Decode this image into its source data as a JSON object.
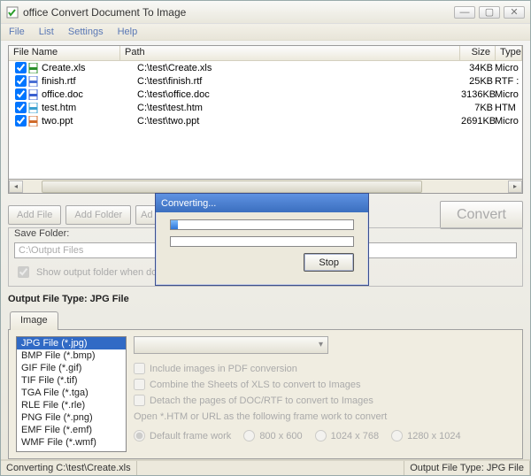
{
  "window": {
    "title": "office Convert Document To Image",
    "buttons": {
      "min": "—",
      "max": "▢",
      "close": "✕"
    }
  },
  "menu": [
    "File",
    "List",
    "Settings",
    "Help"
  ],
  "grid": {
    "columns": {
      "name": "File Name",
      "path": "Path",
      "size": "Size",
      "type": "Type"
    },
    "rows": [
      {
        "checked": true,
        "icon": "xls",
        "name": "Create.xls",
        "path": "C:\\test\\Create.xls",
        "size": "34KB",
        "type": "Micro"
      },
      {
        "checked": true,
        "icon": "rtf",
        "name": "finish.rtf",
        "path": "C:\\test\\finish.rtf",
        "size": "25KB",
        "type": "RTF :"
      },
      {
        "checked": true,
        "icon": "doc",
        "name": "office.doc",
        "path": "C:\\test\\office.doc",
        "size": "3136KB",
        "type": "Micro"
      },
      {
        "checked": true,
        "icon": "htm",
        "name": "test.htm",
        "path": "C:\\test\\test.htm",
        "size": "7KB",
        "type": "HTM"
      },
      {
        "checked": true,
        "icon": "ppt",
        "name": "two.ppt",
        "path": "C:\\test\\two.ppt",
        "size": "2691KB",
        "type": "Micro"
      }
    ]
  },
  "buttons": {
    "addFile": "Add File",
    "addFolder": "Add Folder",
    "addPartial": "Ad",
    "convert": "Convert"
  },
  "saveFolder": {
    "label": "Save Folder:",
    "path": "C:\\Output Files",
    "showOutput": "Show output folder when done",
    "showOutputChecked": true
  },
  "outputFileTypeLabel": "Output File Type:  JPG File",
  "tab": {
    "image": "Image"
  },
  "typeList": [
    "JPG File  (*.jpg)",
    "BMP File  (*.bmp)",
    "GIF File  (*.gif)",
    "TIF File  (*.tif)",
    "TGA File  (*.tga)",
    "RLE File  (*.rle)",
    "PNG File  (*.png)",
    "EMF File  (*.emf)",
    "WMF File  (*.wmf)"
  ],
  "options": {
    "includeImages": "Include images in PDF conversion",
    "combineSheets": "Combine the Sheets of XLS to convert to Images",
    "detachPages": "Detach the pages of DOC/RTF to convert to Images",
    "frameworkNote": "Open *.HTM or URL as the following frame work to convert",
    "sizes": [
      "Default frame work",
      "800 x 600",
      "1024 x 768",
      "1280 x 1024"
    ]
  },
  "statusbar": {
    "left": "Converting  C:\\test\\Create.xls",
    "right": "Output File Type:  JPG File"
  },
  "dialog": {
    "title": "Converting...",
    "stop": "Stop"
  }
}
